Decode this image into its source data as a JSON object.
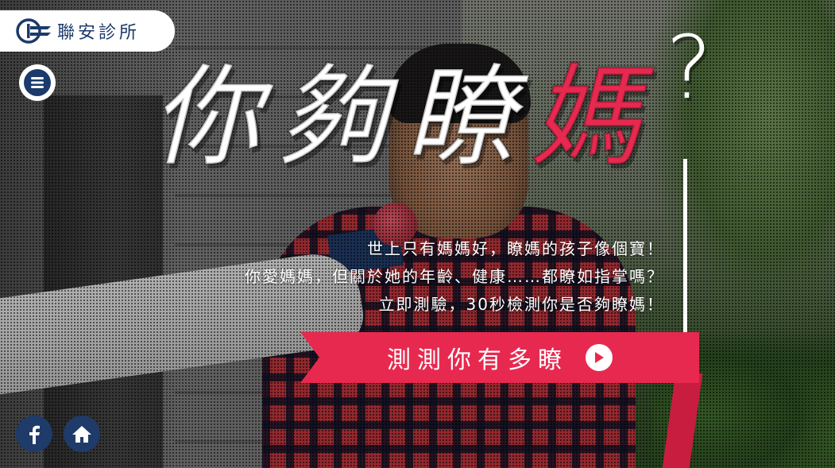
{
  "brand": {
    "name": "聯安診所",
    "color": "#1c3a6b"
  },
  "menu": {
    "icon": "hamburger-menu-icon"
  },
  "headline": {
    "chars": [
      "你",
      "夠",
      "瞭",
      "媽"
    ],
    "question_mark": "?",
    "highlight_color": "#e8294f"
  },
  "taglines": [
    "世上只有媽媽好，瞭媽的孩子像個寶！",
    "你愛媽媽，但關於她的年齡、健康……都瞭如指掌嗎？",
    "立即測驗，30秒檢測你是否夠瞭媽！"
  ],
  "cta": {
    "label": "測測你有多瞭",
    "icon": "play-icon",
    "color": "#e8294f"
  },
  "social": [
    {
      "name": "facebook",
      "icon": "facebook-icon"
    },
    {
      "name": "home",
      "icon": "home-icon"
    }
  ]
}
